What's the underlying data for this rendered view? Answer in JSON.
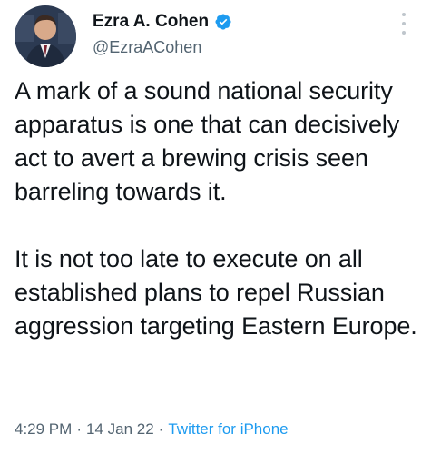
{
  "author": {
    "display_name": "Ezra A. Cohen",
    "handle": "@EzraACohen",
    "verified": true,
    "verified_color": "#1d9bf0",
    "avatar_icon": "profile-photo-icon"
  },
  "tweet": {
    "paragraphs": [
      "A mark of a sound national security apparatus is one that can decisively act to avert a brewing crisis seen barreling towards it.",
      "It is not too late to execute on all established plans to repel Russian aggression targeting Eastern Europe."
    ]
  },
  "meta": {
    "time": "4:29 PM",
    "separator": "·",
    "date": "14 Jan 22",
    "source": "Twitter for iPhone",
    "source_color": "#1d9bf0"
  },
  "icons": {
    "more": "more-options-icon",
    "verified": "verified-badge-icon"
  }
}
